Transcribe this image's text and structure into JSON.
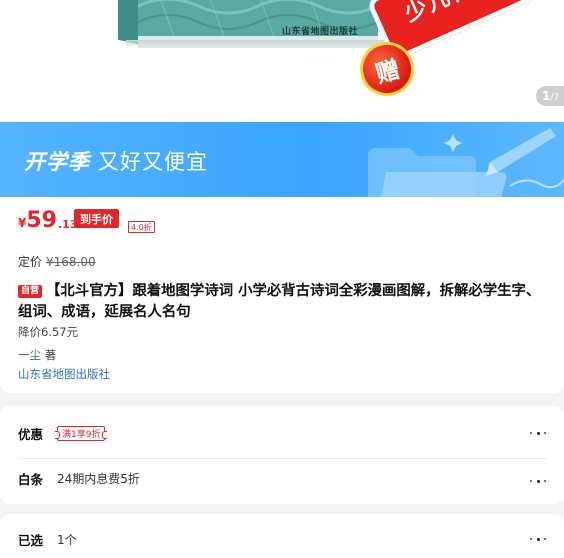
{
  "product_image": {
    "publisher_strip": "山东省地图出版社",
    "gift_banner": "少儿百方图",
    "gift_seal": "赠",
    "counter_current": "1",
    "counter_total": "/7"
  },
  "promo": {
    "title_bold": "开学季",
    "title_rest": "又好又便宜",
    "color": "#3aa4ff"
  },
  "price": {
    "currency": "¥",
    "integer": "59",
    "decimal": ".13",
    "tag": "到手价",
    "discount": "4.0折",
    "list_label": "定价",
    "list_value": "¥168.00",
    "accent": "#e4252b"
  },
  "product": {
    "self_badge": "自营",
    "title": "【北斗官方】跟着地图学诗词 小学必背古诗词全彩漫画图解，拆解必学生字、组词、成语，延展名人名句",
    "drop_price": "降价6.57元",
    "author_name": "一尘",
    "author_suffix": " 著",
    "publisher": "山东省地图出版社"
  },
  "options": {
    "promo_label": "优惠",
    "promo_coupon": "满1享9折",
    "baitiao_label": "白条",
    "baitiao_value": "24期内息费5折",
    "selected_label": "已选",
    "selected_value": "1个"
  }
}
